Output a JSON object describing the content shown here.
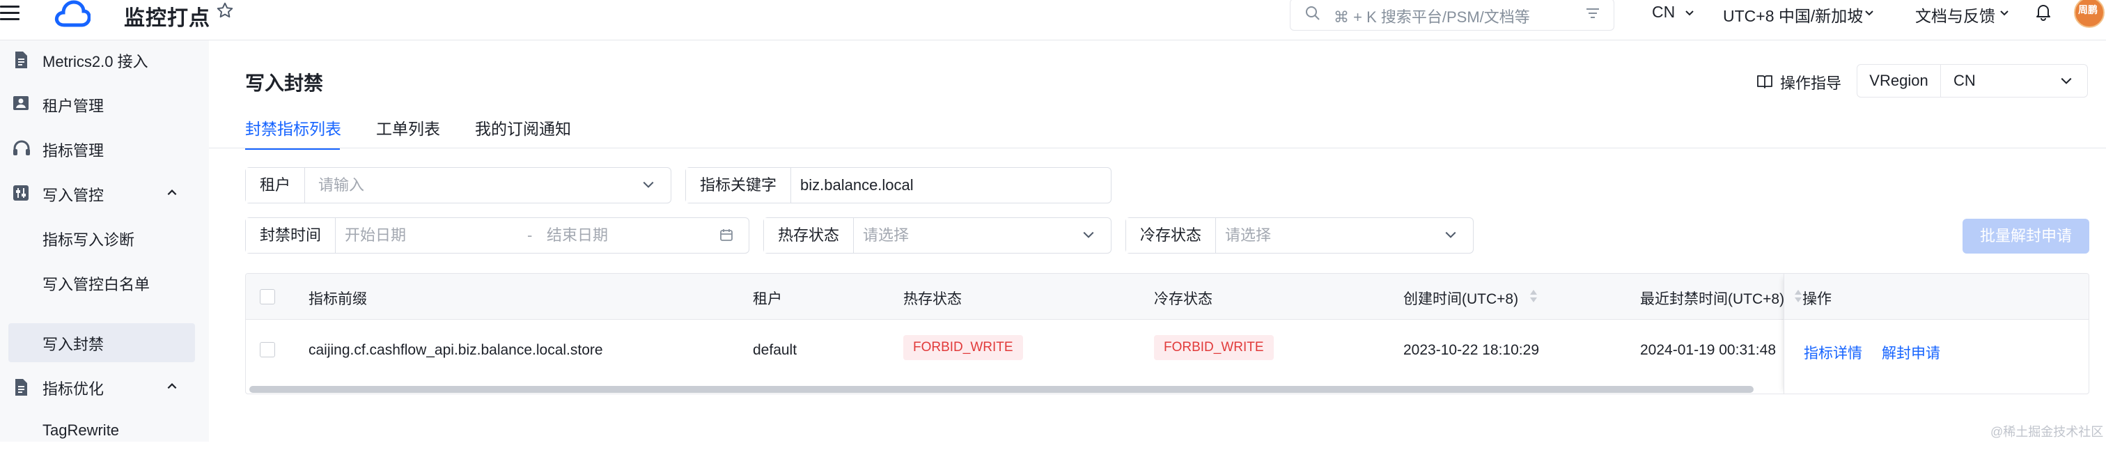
{
  "app": {
    "title": "监控打点"
  },
  "search": {
    "placeholder": "⌘ + K 搜索平台/PSM/文档等"
  },
  "topbar": {
    "region": "CN",
    "timezone": "UTC+8 中国/新加坡",
    "docs": "文档与反馈",
    "avatar_text": "周鹏"
  },
  "sidebar": {
    "items": [
      {
        "label": "Metrics2.0 接入",
        "icon": "document-icon"
      },
      {
        "label": "租户管理",
        "icon": "id-card-icon"
      },
      {
        "label": "指标管理",
        "icon": "headset-icon"
      },
      {
        "label": "写入管控",
        "icon": "sliders-icon",
        "expanded": true
      },
      {
        "label": "指标写入诊断",
        "sub": true
      },
      {
        "label": "写入管控白名单",
        "sub": true
      },
      {
        "label": "写入封禁",
        "sub": true,
        "active": true
      },
      {
        "label": "指标优化",
        "icon": "document-icon",
        "expanded": true
      },
      {
        "label": "TagRewrite",
        "sub": true
      }
    ]
  },
  "page": {
    "title": "写入封禁",
    "tabs": [
      {
        "label": "封禁指标列表",
        "active": true
      },
      {
        "label": "工单列表"
      },
      {
        "label": "我的订阅通知"
      }
    ],
    "guide_label": "操作指导",
    "vregion": {
      "label": "VRegion",
      "value": "CN"
    }
  },
  "filters": {
    "tenant": {
      "label": "租户",
      "placeholder": "请输入"
    },
    "keyword": {
      "label": "指标关键字",
      "value": "biz.balance.local"
    },
    "ban_time": {
      "label": "封禁时间",
      "start_placeholder": "开始日期",
      "separator": "-",
      "end_placeholder": "结束日期"
    },
    "hot_status": {
      "label": "热存状态",
      "placeholder": "请选择"
    },
    "cold_status": {
      "label": "冷存状态",
      "placeholder": "请选择"
    },
    "batch_button": "批量解封申请"
  },
  "table": {
    "columns": [
      "指标前缀",
      "租户",
      "热存状态",
      "冷存状态",
      "创建时间(UTC+8)",
      "最近封禁时间(UTC+8)",
      "操作"
    ],
    "rows": [
      {
        "prefix": "caijing.cf.cashflow_api.biz.balance.local.store",
        "tenant": "default",
        "hot_status": "FORBID_WRITE",
        "cold_status": "FORBID_WRITE",
        "created": "2023-10-22 18:10:29",
        "last_ban": "2024-01-19 00:31:48",
        "actions": [
          "指标详情",
          "解封申请"
        ]
      }
    ]
  },
  "footer": {
    "watermark": "@稀土掘金技术社区"
  },
  "colors": {
    "accent": "#1664ff",
    "danger": "#e13a3a",
    "badge_bg": "#fdecee",
    "sidebar_bg": "#f7f8fa"
  }
}
